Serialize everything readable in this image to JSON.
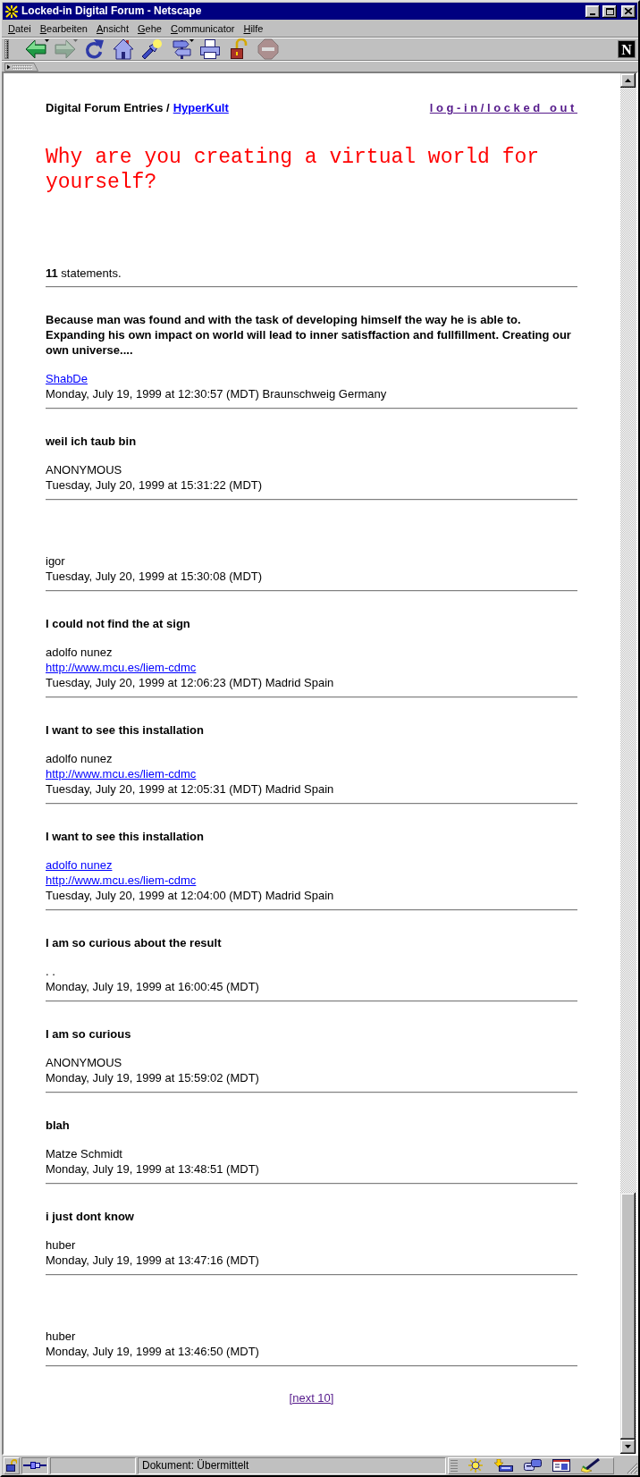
{
  "window": {
    "title": "Locked-in Digital Forum - Netscape"
  },
  "menu": [
    "Datei",
    "Bearbeiten",
    "Ansicht",
    "Gehe",
    "Communicator",
    "Hilfe"
  ],
  "toolbar": [
    {
      "kind": "back",
      "disabled": false,
      "dropdown": true
    },
    {
      "kind": "forward",
      "disabled": true,
      "dropdown": true
    },
    {
      "kind": "reload",
      "disabled": false,
      "dropdown": false
    },
    {
      "kind": "home",
      "disabled": false,
      "dropdown": false
    },
    {
      "kind": "search",
      "disabled": false,
      "dropdown": false
    },
    {
      "kind": "guide",
      "disabled": false,
      "dropdown": true
    },
    {
      "kind": "print",
      "disabled": false,
      "dropdown": false
    },
    {
      "kind": "security",
      "disabled": false,
      "dropdown": false
    },
    {
      "kind": "stop",
      "disabled": true,
      "dropdown": false
    }
  ],
  "logo": "N",
  "page": {
    "section": "Digital Forum Entries /",
    "section_link": {
      "text": "HyperKult",
      "visited": false
    },
    "login_link": {
      "text": "log-in/locked out",
      "visited": true
    },
    "question": "Why are you creating a virtual world for yourself?",
    "count": "**11** statements.",
    "entries": [
      {
        "comment": "Because man was found and with the task of developing himself the way he is able to. Expanding his own impact on world will lead to inner satisffaction and fullfillment. Creating our own universe....",
        "author": "ShabDe",
        "author_link": true,
        "date": "Monday, July 19, 1999 at 12:30:57 (MDT) Braunschweig Germany"
      },
      {
        "comment": "weil ich taub bin",
        "author": "ANONYMOUS",
        "author_link": false,
        "date": "Tuesday, July 20, 1999 at 15:31:22 (MDT)"
      },
      {
        "author": "igor",
        "author_link": false,
        "date": "Tuesday, July 20, 1999 at 15:30:08 (MDT)"
      },
      {
        "comment": "I could not find the at sign",
        "author": "adolfo nunez",
        "author_link": false,
        "url": "http://www.mcu.es/liem-cdmc",
        "date": "Tuesday, July 20, 1999 at 12:06:23 (MDT) Madrid Spain"
      },
      {
        "comment": "I want to see this installation",
        "author": "adolfo nunez",
        "author_link": false,
        "url": "http://www.mcu.es/liem-cdmc",
        "date": "Tuesday, July 20, 1999 at 12:05:31 (MDT) Madrid Spain"
      },
      {
        "comment": "I want to see this installation",
        "author": "adolfo nunez",
        "author_link": true,
        "url": "http://www.mcu.es/liem-cdmc",
        "date": "Tuesday, July 20, 1999 at 12:04:00 (MDT) Madrid Spain"
      },
      {
        "comment": "I am so curious about the result",
        "author": ". .",
        "author_link": false,
        "date": "Monday, July 19, 1999 at 16:00:45 (MDT)"
      },
      {
        "comment": "I am so curious",
        "author": "ANONYMOUS",
        "author_link": false,
        "date": "Monday, July 19, 1999 at 15:59:02 (MDT)"
      },
      {
        "comment": "blah",
        "author": "Matze Schmidt",
        "author_link": false,
        "date": "Monday, July 19, 1999 at 13:48:51 (MDT)"
      },
      {
        "comment": "i just dont know",
        "author": "huber",
        "author_link": false,
        "date": "Monday, July 19, 1999 at 13:47:16 (MDT)"
      },
      {
        "author": "huber",
        "author_link": false,
        "date": "Monday, July 19, 1999 at 13:46:50 (MDT)"
      }
    ],
    "next_link": {
      "text": "[next 10]",
      "visited": true
    }
  },
  "status_bar": {
    "text": "Dokument: Übermittelt"
  }
}
